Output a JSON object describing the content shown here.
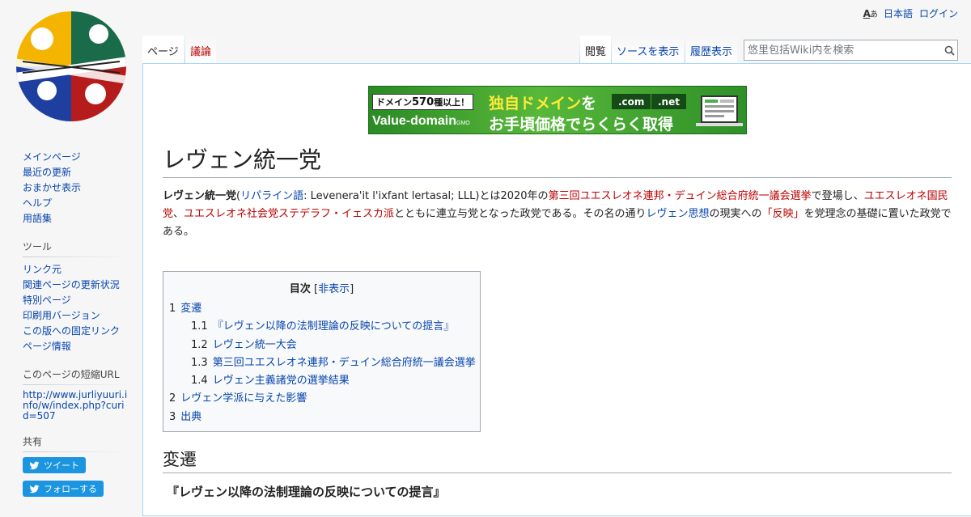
{
  "personal": {
    "language": "日本語",
    "login": "ログイン",
    "lang_icon_a": "A",
    "lang_icon_b": "あ"
  },
  "tabs": {
    "page": "ページ",
    "talk": "議論",
    "read": "閲覧",
    "view_source": "ソースを表示",
    "history": "履歴表示"
  },
  "search": {
    "placeholder": "悠里包括Wiki内を検索"
  },
  "banner": {
    "tag_prefix": "ドメイン",
    "tag_number": "570",
    "tag_suffix": "種以上！",
    "brand": "Value-domain",
    "brand_suffix": "GMO",
    "line1_main": "独自ドメイン",
    "line1_suffix": "を",
    "tld1": ".com",
    "tld2": ".net",
    "line2": "お手頃価格でらくらく取得"
  },
  "sidebar": {
    "navigation": [
      "メインページ",
      "最近の更新",
      "おまかせ表示",
      "ヘルプ",
      "用語集"
    ],
    "tools_heading": "ツール",
    "tools": [
      "リンク元",
      "関連ページの更新状況",
      "特別ページ",
      "印刷用バージョン",
      "この版への固定リンク",
      "ページ情報"
    ],
    "shorturl_heading": "このページの短縮URL",
    "shorturl": "http://www.jurliyuuri.info/w/index.php?curid=507",
    "share_heading": "共有",
    "tweet": "ツイート",
    "follow": "フォローする"
  },
  "article": {
    "title": "レヴェン統一党",
    "intro": {
      "bold": "レヴェン統一党",
      "p1": "(",
      "link1": "リパライン語",
      "p2": ": Levenera'it l'ixfant lertasal; LLL)とは2020年の",
      "link2": "第三回ユエスレオネ連邦・デュイン総合府統一議会選挙",
      "p3": "で登場し、",
      "link3": "ユエスレオネ国民党",
      "p4": "、",
      "link4": "ユエスレオネ社会党ステデラフ・イェスカ派",
      "p5": "とともに連立与党となった政党である。その名の通り",
      "link5": "レヴェン思想",
      "p6": "の現実への",
      "link6": "「反映」",
      "p7": "を党理念の基礎に置いた政党である。"
    }
  },
  "toc": {
    "title": "目次",
    "toggle_open": "[",
    "toggle": "非表示",
    "toggle_close": "]",
    "items": [
      {
        "num": "1",
        "text": "変遷"
      },
      {
        "num": "1.1",
        "text": "『レヴェン以降の法制理論の反映についての提言』"
      },
      {
        "num": "1.2",
        "text": "レヴェン統一大会"
      },
      {
        "num": "1.3",
        "text": "第三回ユエスレオネ連邦・デュイン総合府統一議会選挙"
      },
      {
        "num": "1.4",
        "text": "レヴェン主義諸党の選挙結果"
      },
      {
        "num": "2",
        "text": "レヴェン学派に与えた影響"
      },
      {
        "num": "3",
        "text": "出典"
      }
    ]
  },
  "sections": {
    "h2": "変遷",
    "h3": "『レヴェン以降の法制理論の反映についての提言』"
  }
}
